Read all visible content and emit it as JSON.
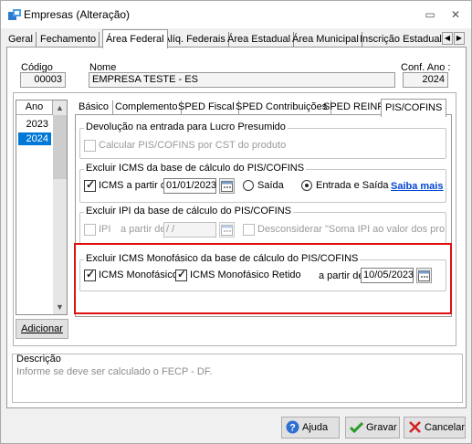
{
  "window": {
    "title": "Empresas (Alteração)",
    "minimize": "▭",
    "close": "✕"
  },
  "main_tabs": [
    {
      "label": "Geral"
    },
    {
      "label": "Fechamento"
    },
    {
      "label": "Área Federal"
    },
    {
      "label": "Alíq. Federais"
    },
    {
      "label": "Área Estadual"
    },
    {
      "label": "Área Municipal"
    },
    {
      "label": "Inscrição Estadual S"
    }
  ],
  "company": {
    "code_label": "Código",
    "code_value": "00003",
    "name_label": "Nome",
    "name_value": "EMPRESA TESTE - ES",
    "conf_label": "Conf. Ano :",
    "conf_value": "2024"
  },
  "years": {
    "header": "Ano",
    "items": [
      "2023",
      "2024"
    ],
    "selected": "2024"
  },
  "add_button": "Adicionar",
  "sub_tabs": [
    {
      "label": "Básico"
    },
    {
      "label": "Complemento"
    },
    {
      "label": "SPED Fiscal"
    },
    {
      "label": "SPED Contribuições"
    },
    {
      "label": "SPED REINF"
    },
    {
      "label": "PIS/COFINS"
    }
  ],
  "groups": {
    "devolucao": {
      "title": "Devolução na entrada para Lucro Presumido",
      "checkbox": "Calcular PIS/COFINS por CST do produto"
    },
    "icms": {
      "title": "Excluir ICMS da base de cálculo do PIS/COFINS",
      "checkbox": "ICMS a partir de:",
      "date": "01/01/2023",
      "radio_saida": "Saída",
      "radio_entrada": "Entrada e Saída",
      "link": "Saiba mais"
    },
    "ipi": {
      "title": "Excluir IPI da base de cálculo do PIS/COFINS",
      "checkbox": "IPI",
      "from_label": "a partir de:",
      "date": " / /",
      "checkbox2": "Desconsiderar \"Soma IPI ao valor dos produtos\""
    },
    "monofasico": {
      "title": "Excluir ICMS Monofásico da base de cálculo do PIS/COFINS",
      "checkbox1": "ICMS Monofásico",
      "checkbox2": "ICMS Monofásico Retido",
      "from_label": "a partir de:",
      "date": "10/05/2023"
    }
  },
  "description": {
    "label": "Descrição",
    "text": "Informe se deve ser calculado o FECP - DF."
  },
  "footer": {
    "help": "Ajuda",
    "save": "Gravar",
    "cancel": "Cancelar"
  },
  "colors": {
    "highlight": "#e01010",
    "selection": "#0078d7",
    "link": "#0046d5"
  }
}
